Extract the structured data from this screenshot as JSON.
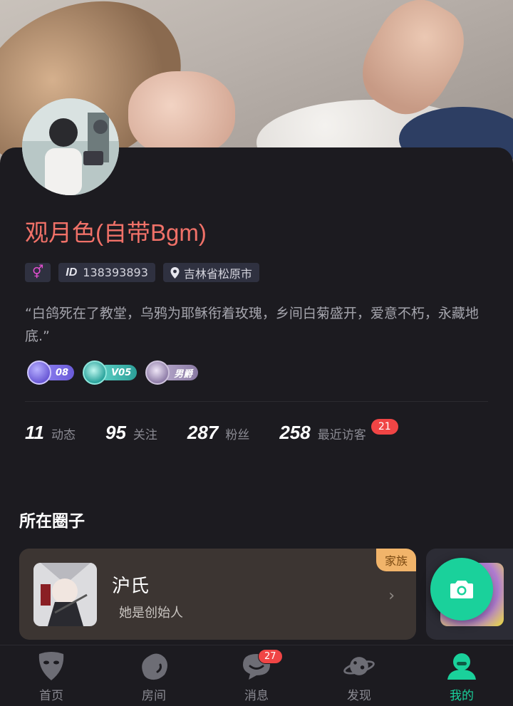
{
  "profile": {
    "nickname": "观月色(自带Bgm)",
    "gender_icon": "female-symbol-icon",
    "id_label": "ID",
    "id_value": "138393893",
    "location": "吉林省松原市",
    "bio": "“白鸽死在了教堂，乌鸦为耶稣衔着玫瑰，乡间白菊盛开，爱意不朽，永藏地底.”"
  },
  "badges": [
    {
      "icon": "level-star-icon",
      "text": "08",
      "color": "#7c6ee0"
    },
    {
      "icon": "vip-emblem-icon",
      "text": "V05",
      "color": "#39b7b0"
    },
    {
      "icon": "rank-crest-icon",
      "text": "男爵",
      "color": "#9a8ab8"
    }
  ],
  "stats": [
    {
      "num": "11",
      "label": "动态"
    },
    {
      "num": "95",
      "label": "关注"
    },
    {
      "num": "287",
      "label": "粉丝"
    },
    {
      "num": "258",
      "label": "最近访客",
      "badge": "21"
    }
  ],
  "circles": {
    "title": "所在圈子",
    "items": [
      {
        "name": "沪氏",
        "role": "她是创始人",
        "tag": "家族"
      }
    ]
  },
  "tabbar": [
    {
      "label": "首页",
      "icon": "mask-icon"
    },
    {
      "label": "房间",
      "icon": "room-blob-icon"
    },
    {
      "label": "消息",
      "icon": "chat-bubble-icon",
      "badge": "27"
    },
    {
      "label": "发现",
      "icon": "planet-icon"
    },
    {
      "label": "我的",
      "icon": "profile-character-icon",
      "active": true
    }
  ],
  "colors": {
    "accent": "#1ad19b",
    "nickname": "#f07168",
    "badge_red": "#f04545",
    "family_tag": "#f1b46a"
  }
}
